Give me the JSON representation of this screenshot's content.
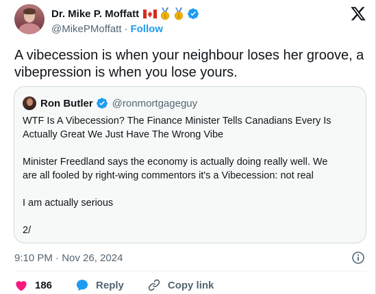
{
  "author": {
    "display_name": "Dr. Mike P. Moffatt",
    "handle": "@MikePMoffatt",
    "separator": "·",
    "follow_label": "Follow",
    "badges": [
      "canada-flag-icon",
      "medal-icon",
      "medal-icon",
      "verified-icon"
    ]
  },
  "tweet": {
    "text": "A vibecession is when your neighbour loses her groove, a vibepression is when you lose yours."
  },
  "quoted": {
    "display_name": "Ron Butler",
    "handle": "@ronmortgageguy",
    "paragraphs": [
      "WTF Is A Vibecession? The Finance Minister Tells Canadians Every Is Actually Great We Just Have The Wrong Vibe",
      "Minister Freedland says the economy is actually doing really well. We are all fooled by right-wing commentors it's a Vibecession: not real",
      "I am actually serious",
      "2/"
    ]
  },
  "footer": {
    "timestamp": "9:10 PM · Nov 26, 2024",
    "like_count": "186",
    "reply_label": "Reply",
    "copy_link_label": "Copy link"
  },
  "colors": {
    "accent": "#1d9bf0",
    "like": "#f91880",
    "muted": "#536471",
    "text": "#0f1419",
    "gold": "#f4b400"
  }
}
